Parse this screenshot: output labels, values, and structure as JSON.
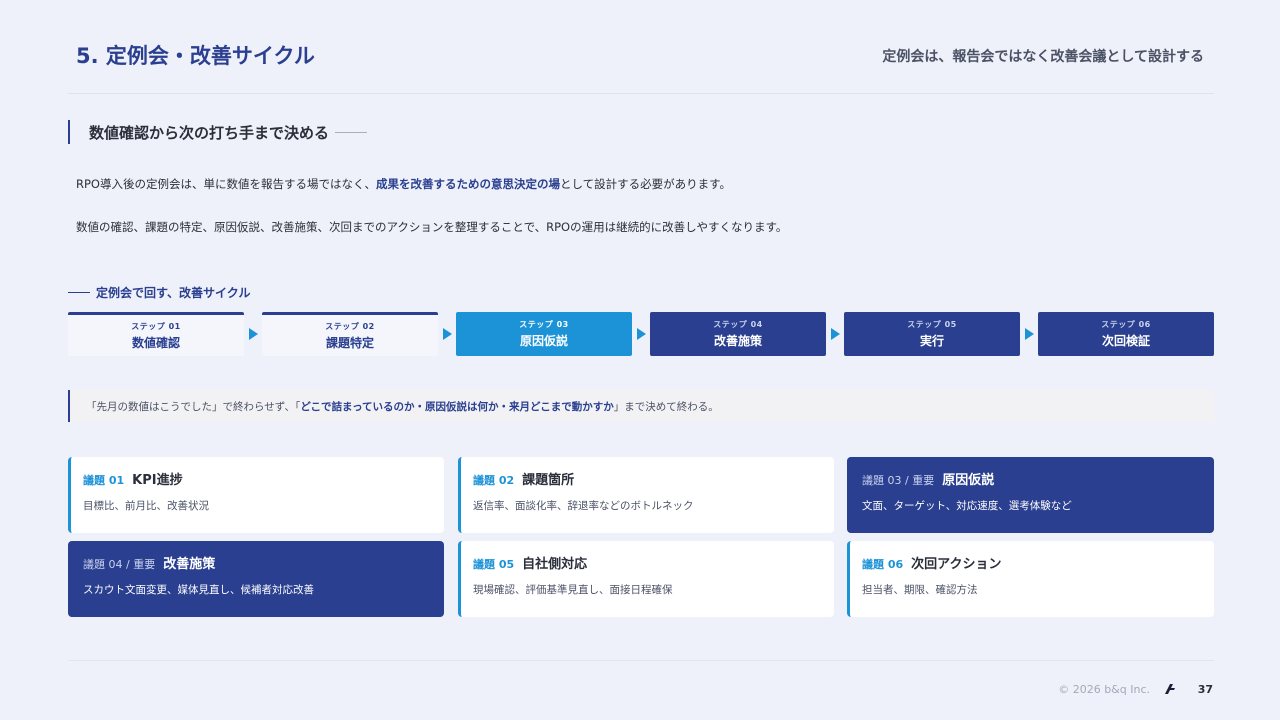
{
  "header": {
    "title": "5. 定例会・改善サイクル",
    "subtitle": "定例会は、報告会ではなく改善会議として設計する"
  },
  "section": {
    "heading": "数値確認から次の打ち手まで決める"
  },
  "intro": {
    "p1_before": "RPO導入後の定例会は、単に数値を報告する場ではなく、",
    "p1_highlight": "成果を改善するための意思決定の場",
    "p1_after": "として設計する必要があります。",
    "p2": "数値の確認、課題の特定、原因仮説、改善施策、次回までのアクションを整理することで、RPOの運用は継続的に改善しやすくなります。"
  },
  "cycle": {
    "label": "定例会で回す、改善サイクル",
    "steps": [
      {
        "num": "ステップ 01",
        "name": "数値確認"
      },
      {
        "num": "ステップ 02",
        "name": "課題特定"
      },
      {
        "num": "ステップ 03",
        "name": "原因仮説"
      },
      {
        "num": "ステップ 04",
        "name": "改善施策"
      },
      {
        "num": "ステップ 05",
        "name": "実行"
      },
      {
        "num": "ステップ 06",
        "name": "次回検証"
      }
    ]
  },
  "note": {
    "before": "「先月の数値はこうでした」で終わらせず、「",
    "highlight": "どこで詰まっているのか・原因仮説は何か・来月どこまで動かすか",
    "after": "」まで決めて終わる。"
  },
  "agenda": [
    {
      "tag": "議題 01",
      "title": "KPI進捗",
      "desc": "目標比、前月比、改善状況"
    },
    {
      "tag": "議題 02",
      "title": "課題箇所",
      "desc": "返信率、面談化率、辞退率などのボトルネック"
    },
    {
      "tag": "議題 03 / 重要",
      "title": "原因仮説",
      "desc": "文面、ターゲット、対応速度、選考体験など"
    },
    {
      "tag": "議題 04 / 重要",
      "title": "改善施策",
      "desc": "スカウト文面変更、媒体見直し、候補者対応改善"
    },
    {
      "tag": "議題 05",
      "title": "自社側対応",
      "desc": "現場確認、評価基準見直し、面接日程確保"
    },
    {
      "tag": "議題 06",
      "title": "次回アクション",
      "desc": "担当者、期限、確認方法"
    }
  ],
  "footer": {
    "copyright": "© 2026 b&q Inc.",
    "page": "37"
  },
  "colors": {
    "brand": "#2a3f8f",
    "accent": "#1d93d7",
    "background": "#eef1f9"
  }
}
